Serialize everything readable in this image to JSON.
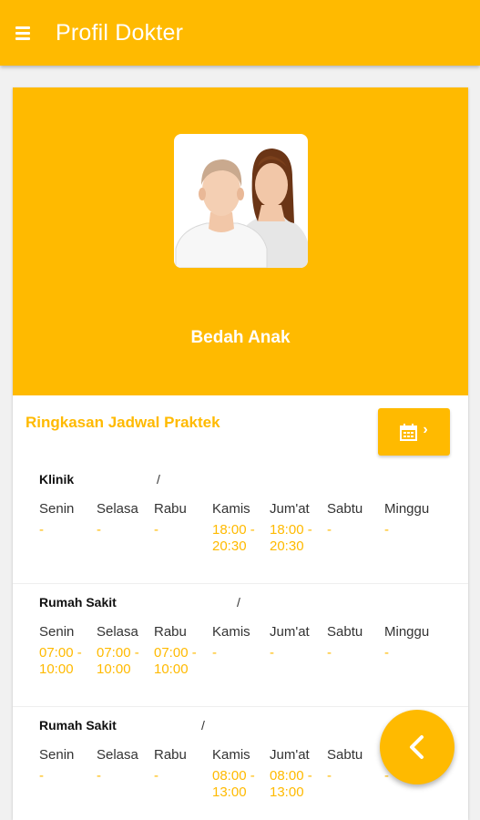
{
  "appbar": {
    "title": "Profil Dokter",
    "menu_icon": "hamburger-menu-icon"
  },
  "profile": {
    "specialty": "Bedah Anak",
    "avatar_icon": "doctor-couple-avatar"
  },
  "schedule": {
    "title": "Ringkasan Jadwal Praktek",
    "calendar_icon": "calendar-icon",
    "chevron": "›",
    "days": [
      "Senin",
      "Selasa",
      "Rabu",
      "Kamis",
      "Jum'at",
      "Sabtu",
      "Minggu"
    ],
    "locations": [
      {
        "name": "Klinik",
        "separator": "/",
        "times": [
          "-",
          "-",
          "-",
          "18:00 -\n20:30",
          "18:00 -\n20:30",
          "-",
          "-"
        ]
      },
      {
        "name": "Rumah Sakit",
        "separator": "/",
        "times": [
          "07:00 -\n10:00",
          "07:00 -\n10:00",
          "07:00 -\n10:00",
          "-",
          "-",
          "-",
          "-"
        ]
      },
      {
        "name": "Rumah Sakit",
        "separator": "/",
        "times": [
          "-",
          "-",
          "-",
          "08:00 -\n13:00",
          "08:00 -\n13:00",
          "-",
          "-"
        ]
      }
    ]
  },
  "fab": {
    "icon": "chevron-left-icon"
  },
  "colors": {
    "accent": "#ffba00",
    "white": "#ffffff"
  }
}
